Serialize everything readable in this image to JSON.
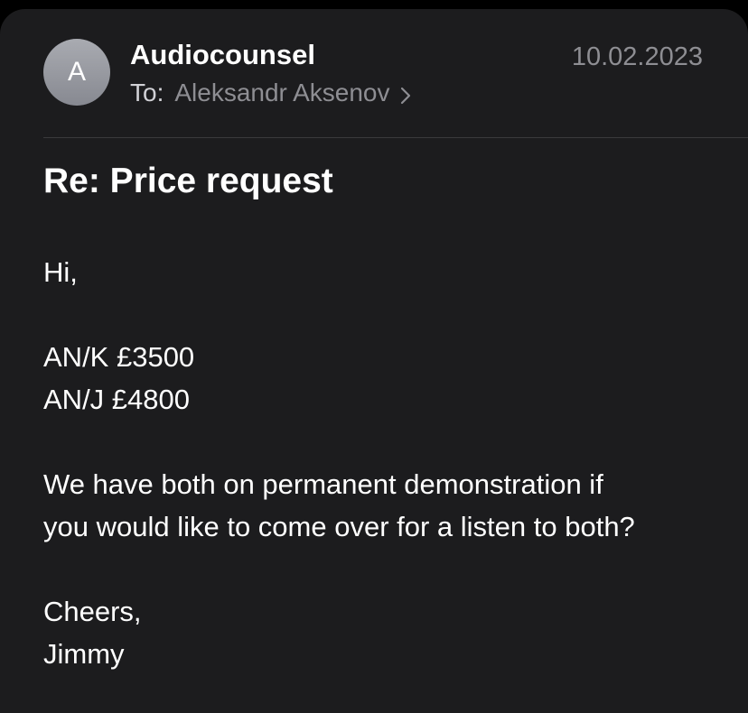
{
  "email": {
    "avatar_initial": "A",
    "sender": "Audiocounsel",
    "date": "10.02.2023",
    "to_label": "To:",
    "recipient": "Aleksandr Aksenov",
    "subject": "Re: Price request",
    "body": {
      "greeting": "Hi,",
      "price_line_1": "AN/K £3500",
      "price_line_2": "AN/J £4800",
      "paragraph_line_1": "We have both on permanent demonstration if",
      "paragraph_line_2": "you would like to come over for a listen to both?",
      "signoff": "Cheers,",
      "signature": "Jimmy"
    }
  },
  "colors": {
    "background": "#1c1c1e",
    "secondary_text": "#8e8e93",
    "avatar": "#9a9ca2"
  },
  "icons": {
    "recipient_chevron": "chevron-right-icon"
  }
}
